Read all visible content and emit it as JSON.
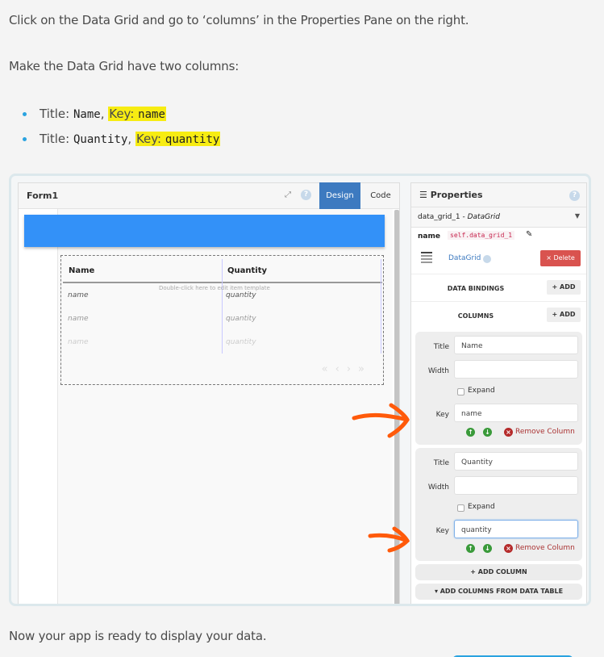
{
  "instructions": {
    "step1": "Click on the Data Grid and go to ‘columns’ in the Properties Pane on the right.",
    "step2": "Make the Data Grid have two columns:",
    "bullets": [
      {
        "title_prefix": "Title: ",
        "title_value": "Name",
        "sep": ", ",
        "key_prefix": "Key: ",
        "key_value": "name"
      },
      {
        "title_prefix": "Title: ",
        "title_value": "Quantity",
        "sep": ", ",
        "key_prefix": "Key: ",
        "key_value": "quantity"
      }
    ],
    "closing": "Now your app is ready to display your data."
  },
  "designer": {
    "form_title": "Form1",
    "expand_icon": "expand-icon",
    "help_glyph": "?",
    "tabs": [
      {
        "label": "Design",
        "active": true
      },
      {
        "label": "Code",
        "active": false
      }
    ],
    "grid": {
      "headers": [
        "Name",
        "Quantity"
      ],
      "hint": "Double-click here to edit item template",
      "rows": [
        [
          "name",
          "quantity"
        ],
        [
          "name",
          "quantity"
        ],
        [
          "name",
          "quantity"
        ]
      ],
      "pager": [
        "«",
        "‹",
        "›",
        "»"
      ]
    }
  },
  "properties": {
    "title": "Properties",
    "title_icon": "☰",
    "help_glyph": "?",
    "component": {
      "name": "data_grid_1",
      "sep": " - ",
      "type": "DataGrid"
    },
    "name_label": "name",
    "name_value": "self.data_grid_1",
    "type_label": "DataGrid",
    "delete_label": "× Delete",
    "sections": {
      "data_bindings": "DATA BINDINGS",
      "columns": "COLUMNS",
      "add_label": "+ ADD"
    },
    "column_labels": {
      "title": "Title",
      "width": "Width",
      "expand": "Expand",
      "key": "Key",
      "remove": "Remove Column"
    },
    "columns": [
      {
        "title": "Name",
        "width": "",
        "expand": false,
        "key": "name"
      },
      {
        "title": "Quantity",
        "width": "",
        "expand": false,
        "key": "quantity"
      }
    ],
    "add_column_label": "+ ADD COLUMN",
    "add_from_table_label": "▾ ADD COLUMNS FROM DATA TABLE"
  },
  "colors": {
    "highlight": "#f7ec12",
    "accent_blue": "#3391f8",
    "design_tab": "#3d7ac0",
    "delete_red": "#d9534f",
    "annotation_orange": "#ff5a0a",
    "bullet": "#2aa3e0"
  }
}
